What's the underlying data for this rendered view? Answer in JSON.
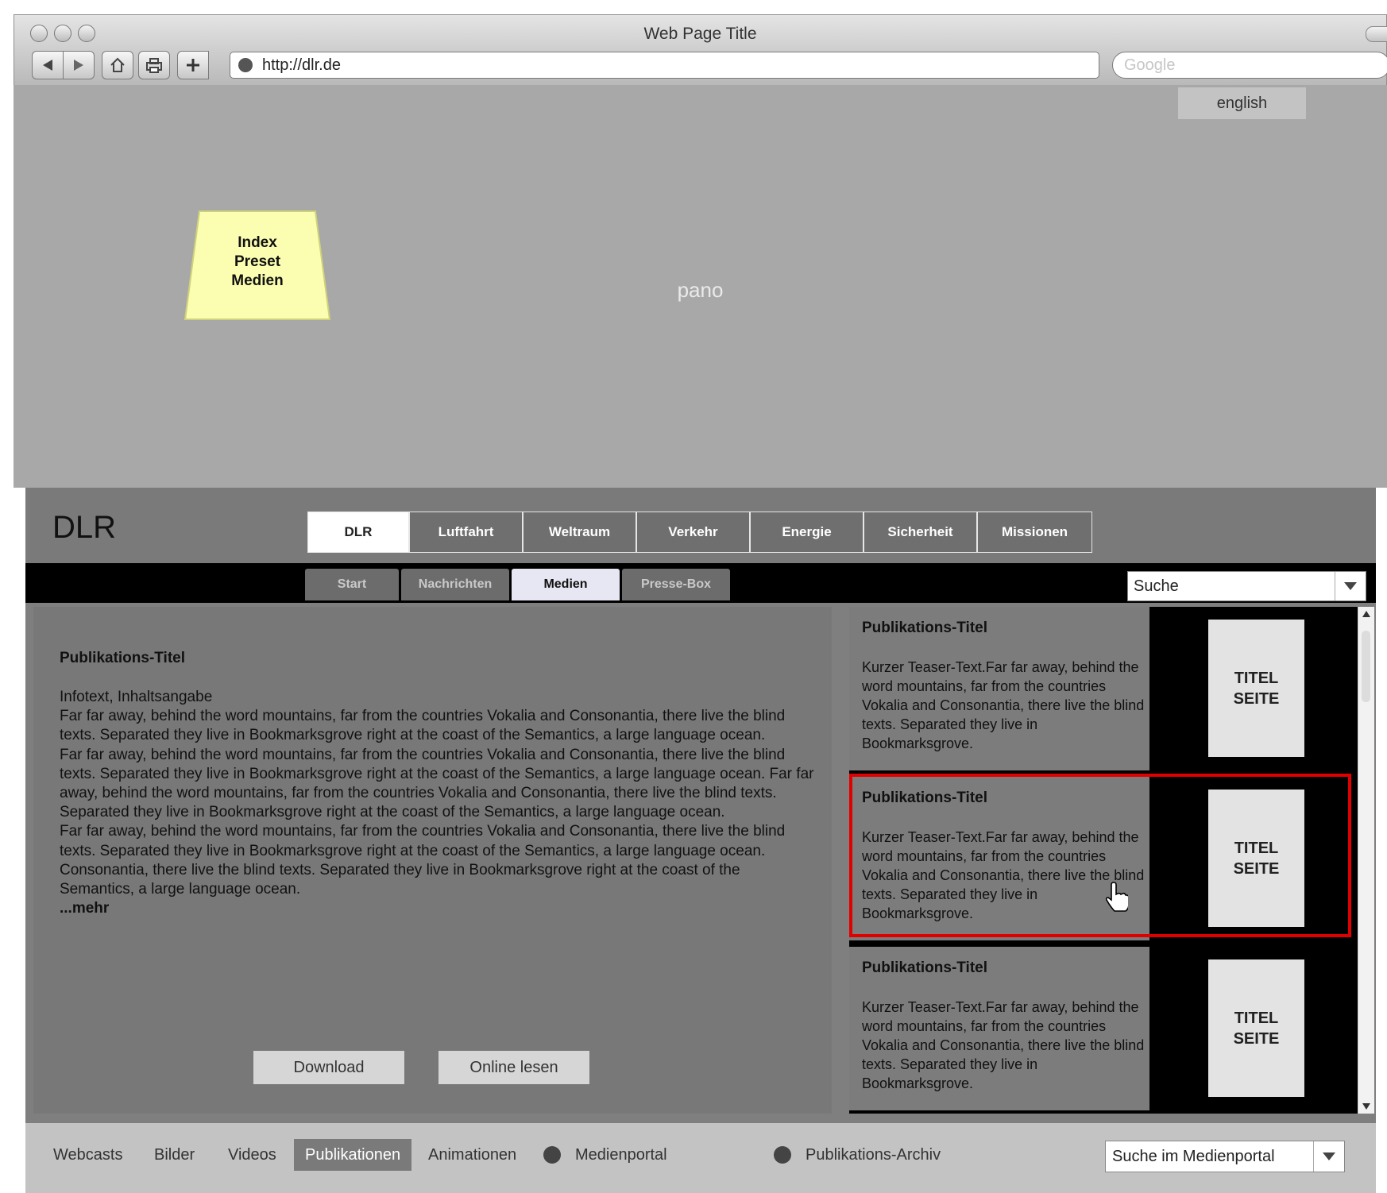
{
  "browser": {
    "window_title": "Web Page Title",
    "url": "http://dlr.de",
    "search_placeholder": "Google"
  },
  "pano": {
    "language_button": "english",
    "sticky_note_lines": [
      "Index",
      "Preset",
      "Medien"
    ],
    "label": "pano"
  },
  "site": {
    "logo": "DLR",
    "main_nav": [
      {
        "label": "DLR",
        "active": true
      },
      {
        "label": "Luftfahrt"
      },
      {
        "label": "Weltraum"
      },
      {
        "label": "Verkehr"
      },
      {
        "label": "Energie"
      },
      {
        "label": "Sicherheit"
      },
      {
        "label": "Missionen"
      }
    ],
    "sub_nav": [
      {
        "label": "Start"
      },
      {
        "label": "Nachrichten"
      },
      {
        "label": "Medien",
        "active": true
      },
      {
        "label": "Presse-Box"
      }
    ],
    "search_value": "Suche"
  },
  "publication": {
    "title": "Publikations-Titel",
    "paragraphs": [
      "Infotext, Inhaltsangabe",
      "Far far away, behind the word mountains, far from the countries Vokalia and Consonantia, there live the blind texts. Separated they live in Bookmarksgrove right at the coast of the Semantics, a large language ocean.",
      "Far far away, behind the word mountains, far from the countries Vokalia and Consonantia, there live the blind texts. Separated they live in Bookmarksgrove right at the coast of the Semantics, a large language ocean. Far far away, behind the word mountains, far from the countries Vokalia and Consonantia, there live the blind texts. Separated they live in Bookmarksgrove right at the coast of the Semantics, a large language ocean.",
      "Far far away, behind the word mountains, far from the countries Vokalia and Consonantia, there live the blind texts. Separated they live in Bookmarksgrove right at the coast of the Semantics, a large language ocean.",
      "Consonantia, there live the blind texts. Separated they live in Bookmarksgrove right at the coast of the Semantics, a large language ocean."
    ],
    "more": "...mehr",
    "download_label": "Download",
    "read_online_label": "Online lesen"
  },
  "list": {
    "items": [
      {
        "title": "Publikations-Titel",
        "teaser": "Kurzer Teaser-Text.Far far away, behind the word mountains, far from the countries Vokalia and Consonantia, there live the blind texts. Separated they live in Bookmarksgrove.",
        "cover": "TITEL SEITE"
      },
      {
        "title": "Publikations-Titel",
        "teaser": "Kurzer Teaser-Text.Far far away, behind the word mountains, far from the countries Vokalia and Consonantia, there live the blind texts. Separated they live in Bookmarksgrove.",
        "cover": "TITEL SEITE",
        "selected": true
      },
      {
        "title": "Publikations-Titel",
        "teaser": "Kurzer Teaser-Text.Far far away, behind the word mountains, far from the countries Vokalia and Consonantia, there live the blind texts. Separated they live in Bookmarksgrove.",
        "cover": "TITEL SEITE"
      }
    ]
  },
  "footer": {
    "links": [
      "Webcasts",
      "Bilder",
      "Videos",
      "Publikationen",
      "Animationen"
    ],
    "active_link": "Publikationen",
    "medienportal": "Medienportal",
    "archive": "Publikations-Archiv",
    "search_value": "Suche im Medienportal"
  },
  "colors": {
    "selection_border": "#e00000",
    "sticky_note": "#fbfdb0",
    "active_sub_tab": "#e7e7f3"
  }
}
